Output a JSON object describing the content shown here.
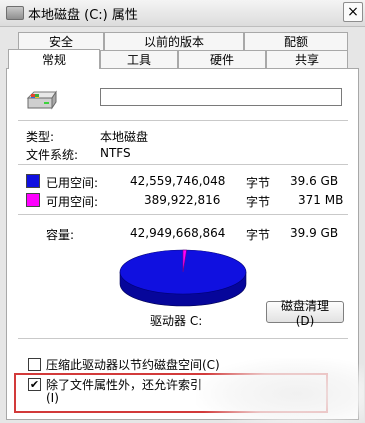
{
  "window": {
    "title": "本地磁盘 (C:) 属性",
    "close_label": "×"
  },
  "tabs_row1": [
    "安全",
    "以前的版本",
    "配额"
  ],
  "tabs_row2": [
    "常规",
    "工具",
    "硬件",
    "共享"
  ],
  "active_tab": "常规",
  "general": {
    "name_value": "",
    "type_label": "类型:",
    "type_value": "本地磁盘",
    "fs_label": "文件系统:",
    "fs_value": "NTFS",
    "used": {
      "label": "已用空间:",
      "bytes": "42,559,746,048",
      "unit": "字节",
      "size": "39.6 GB",
      "color": "#1010e0"
    },
    "free": {
      "label": "可用空间:",
      "bytes": "389,922,816",
      "unit": "字节",
      "size": "371 MB",
      "color": "#ff00ff"
    },
    "capacity": {
      "label": "容量:",
      "bytes": "42,949,668,864",
      "unit": "字节",
      "size": "39.9 GB"
    },
    "drive_label": "驱动器 C:",
    "cleanup_button": "磁盘清理(D)",
    "compress_label": "压缩此驱动器以节约磁盘空间(C)",
    "compress_checked": false,
    "index_label_line1": "除了文件属性外，还允许索引",
    "index_label_line2": "(I)",
    "index_checked": true,
    "index_check_glyph": "✔",
    "pie_used_fraction": 0.991
  }
}
